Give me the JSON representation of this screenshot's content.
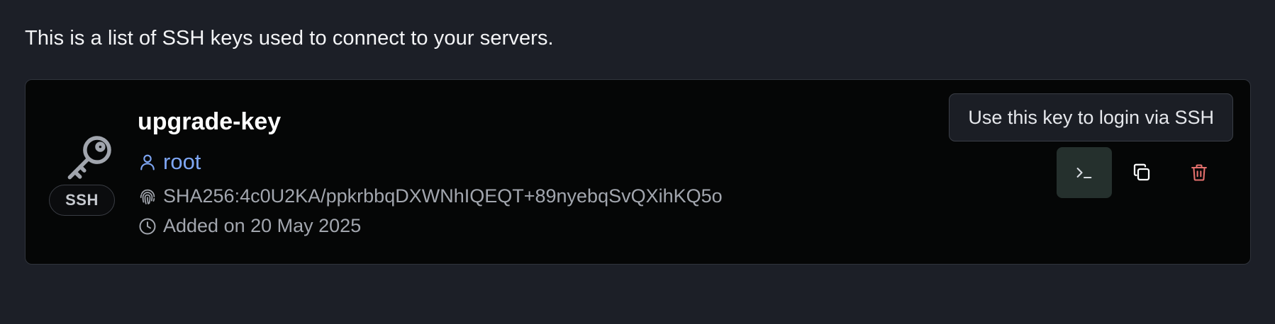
{
  "header": {
    "description": "This is a list of SSH keys used to connect to your servers."
  },
  "key": {
    "name": "upgrade-key",
    "badge": "SSH",
    "user": "root",
    "fingerprint": "SHA256:4c0U2KA/ppkrbbqDXWNhIQEQT+89nyebqSvQXihKQ5o",
    "added": "Added on 20 May 2025"
  },
  "actions": {
    "tooltip": "Use this key to login via SSH",
    "terminal_icon": "terminal-icon",
    "copy_icon": "copy-icon",
    "delete_icon": "trash-icon"
  },
  "colors": {
    "background": "#1c1f27",
    "card": "#050606",
    "user_accent": "#7ea6f4",
    "delete": "#e5706d",
    "terminal_button": "#25302d"
  }
}
